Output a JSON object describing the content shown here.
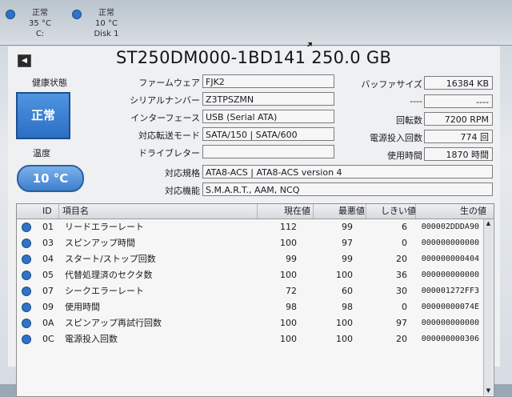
{
  "disks": [
    {
      "status": "正常",
      "temp": "35 °C",
      "name": "C:"
    },
    {
      "status": "正常",
      "temp": "10 °C",
      "name": "Disk 1"
    }
  ],
  "title": "ST250DM000-1BD141 250.0 GB",
  "health": {
    "label": "健康状態",
    "value": "正常"
  },
  "temperature": {
    "label": "温度",
    "value": "10 °C"
  },
  "fields_left": [
    {
      "label": "ファームウェア",
      "value": "FJK2"
    },
    {
      "label": "シリアルナンバー",
      "value": "Z3TPSZMN"
    },
    {
      "label": "インターフェース",
      "value": "USB (Serial ATA)"
    },
    {
      "label": "対応転送モード",
      "value": "SATA/150 | SATA/600"
    },
    {
      "label": "ドライブレター",
      "value": ""
    }
  ],
  "fields_right": [
    {
      "label": "バッファサイズ",
      "value": "16384 KB"
    },
    {
      "label": "----",
      "value": "----"
    },
    {
      "label": "回転数",
      "value": "7200 RPM"
    },
    {
      "label": "電源投入回数",
      "value": "774 回"
    },
    {
      "label": "使用時間",
      "value": "1870 時間"
    }
  ],
  "standard": {
    "label": "対応規格",
    "value": "ATA8-ACS | ATA8-ACS version 4"
  },
  "features": {
    "label": "対応機能",
    "value": "S.M.A.R.T., AAM, NCQ"
  },
  "table": {
    "headers": {
      "id": "ID",
      "name": "項目名",
      "current": "現在値",
      "worst": "最悪値",
      "threshold": "しきい値",
      "raw": "生の値"
    },
    "rows": [
      {
        "id": "01",
        "name": "リードエラーレート",
        "current": "112",
        "worst": "99",
        "threshold": "6",
        "raw": "000002DDDA90"
      },
      {
        "id": "03",
        "name": "スピンアップ時間",
        "current": "100",
        "worst": "97",
        "threshold": "0",
        "raw": "000000000000"
      },
      {
        "id": "04",
        "name": "スタート/ストップ回数",
        "current": "99",
        "worst": "99",
        "threshold": "20",
        "raw": "000000000404"
      },
      {
        "id": "05",
        "name": "代替処理済のセクタ数",
        "current": "100",
        "worst": "100",
        "threshold": "36",
        "raw": "000000000000"
      },
      {
        "id": "07",
        "name": "シークエラーレート",
        "current": "72",
        "worst": "60",
        "threshold": "30",
        "raw": "000001272FF3"
      },
      {
        "id": "09",
        "name": "使用時間",
        "current": "98",
        "worst": "98",
        "threshold": "0",
        "raw": "00000000074E"
      },
      {
        "id": "0A",
        "name": "スピンアップ再試行回数",
        "current": "100",
        "worst": "100",
        "threshold": "97",
        "raw": "000000000000"
      },
      {
        "id": "0C",
        "name": "電源投入回数",
        "current": "100",
        "worst": "100",
        "threshold": "20",
        "raw": "000000000306"
      }
    ]
  },
  "colors": {
    "accent": "#2f73c9",
    "health_bg": "#3a7fd0"
  }
}
